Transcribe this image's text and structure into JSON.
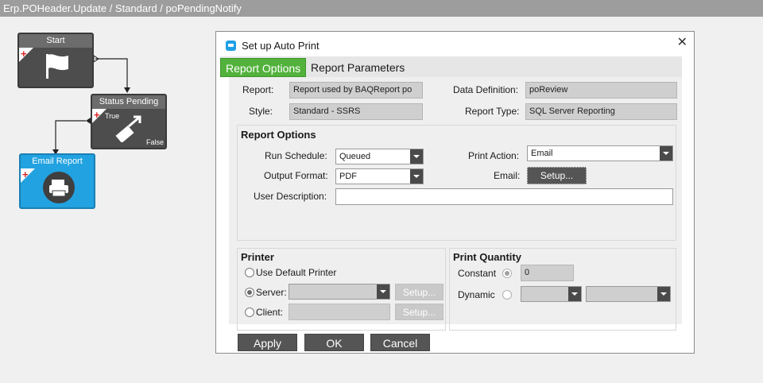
{
  "window": {
    "title": "Erp.POHeader.Update / Standard / poPendingNotify"
  },
  "workflow": {
    "start_node": {
      "label": "Start",
      "icon": "flag-icon"
    },
    "status_node": {
      "label": "Status Pending",
      "true_label": "True",
      "false_label": "False",
      "icon": "pencil-arrow-icon"
    },
    "email_node": {
      "label": "Email Report",
      "icon": "printer-icon"
    },
    "colors": {
      "gray_node": "#4d4d4d",
      "blue_node": "#22a2e0",
      "plus": "#e02424"
    }
  },
  "dialog": {
    "title": "Set up Auto Print",
    "close_label": "✕",
    "tabs": [
      {
        "label": "Report Options",
        "active": true
      },
      {
        "label": "Report Parameters",
        "active": false
      }
    ],
    "report": {
      "label": "Report:",
      "value": "Report used by BAQReport po"
    },
    "style": {
      "label": "Style:",
      "value": "Standard - SSRS"
    },
    "data_definition": {
      "label": "Data Definition:",
      "value": "poReview"
    },
    "report_type": {
      "label": "Report Type:",
      "value": "SQL Server Reporting"
    },
    "report_options": {
      "title": "Report Options",
      "run_schedule": {
        "label": "Run Schedule:",
        "value": "Queued"
      },
      "output_format": {
        "label": "Output Format:",
        "value": "PDF"
      },
      "user_description": {
        "label": "User Description:",
        "value": ""
      },
      "print_action": {
        "label": "Print Action:",
        "value": "Email"
      },
      "email": {
        "label": "Email:",
        "button": "Setup..."
      }
    },
    "printer": {
      "title": "Printer",
      "use_default": "Use Default Printer",
      "server": {
        "label": "Server:",
        "setup": "Setup..."
      },
      "client": {
        "label": "Client:",
        "setup": "Setup..."
      }
    },
    "print_quantity": {
      "title": "Print Quantity",
      "constant": {
        "label": "Constant",
        "value": "0"
      },
      "dynamic": {
        "label": "Dynamic"
      }
    },
    "buttons": {
      "apply": "Apply",
      "ok": "OK",
      "cancel": "Cancel"
    },
    "colors": {
      "tab_active": "#52b23c",
      "dark_button": "#555555",
      "accent_icon": "#1ea0e6"
    }
  }
}
